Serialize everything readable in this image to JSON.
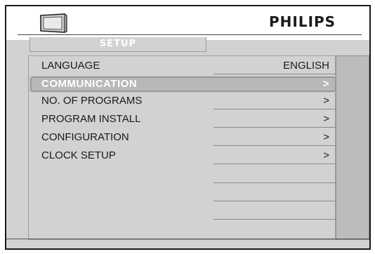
{
  "header": {
    "brand": "PHILIPS",
    "icon": "tv-icon"
  },
  "menu": {
    "title": "SETUP",
    "items": [
      {
        "label": "LANGUAGE",
        "value": "ENGLISH",
        "selected": false
      },
      {
        "label": "COMMUNICATION",
        "value": ">",
        "selected": true
      },
      {
        "label": "NO. OF PROGRAMS",
        "value": ">",
        "selected": false
      },
      {
        "label": "PROGRAM INSTALL",
        "value": ">",
        "selected": false
      },
      {
        "label": "CONFIGURATION",
        "value": ">",
        "selected": false
      },
      {
        "label": "CLOCK SETUP",
        "value": ">",
        "selected": false
      }
    ]
  },
  "colors": {
    "background": "#d2d2d2",
    "header": "#ffffff",
    "selected_text": "#ffffff",
    "text": "#1a1a1a",
    "scroll_area": "#bcbcbc"
  }
}
